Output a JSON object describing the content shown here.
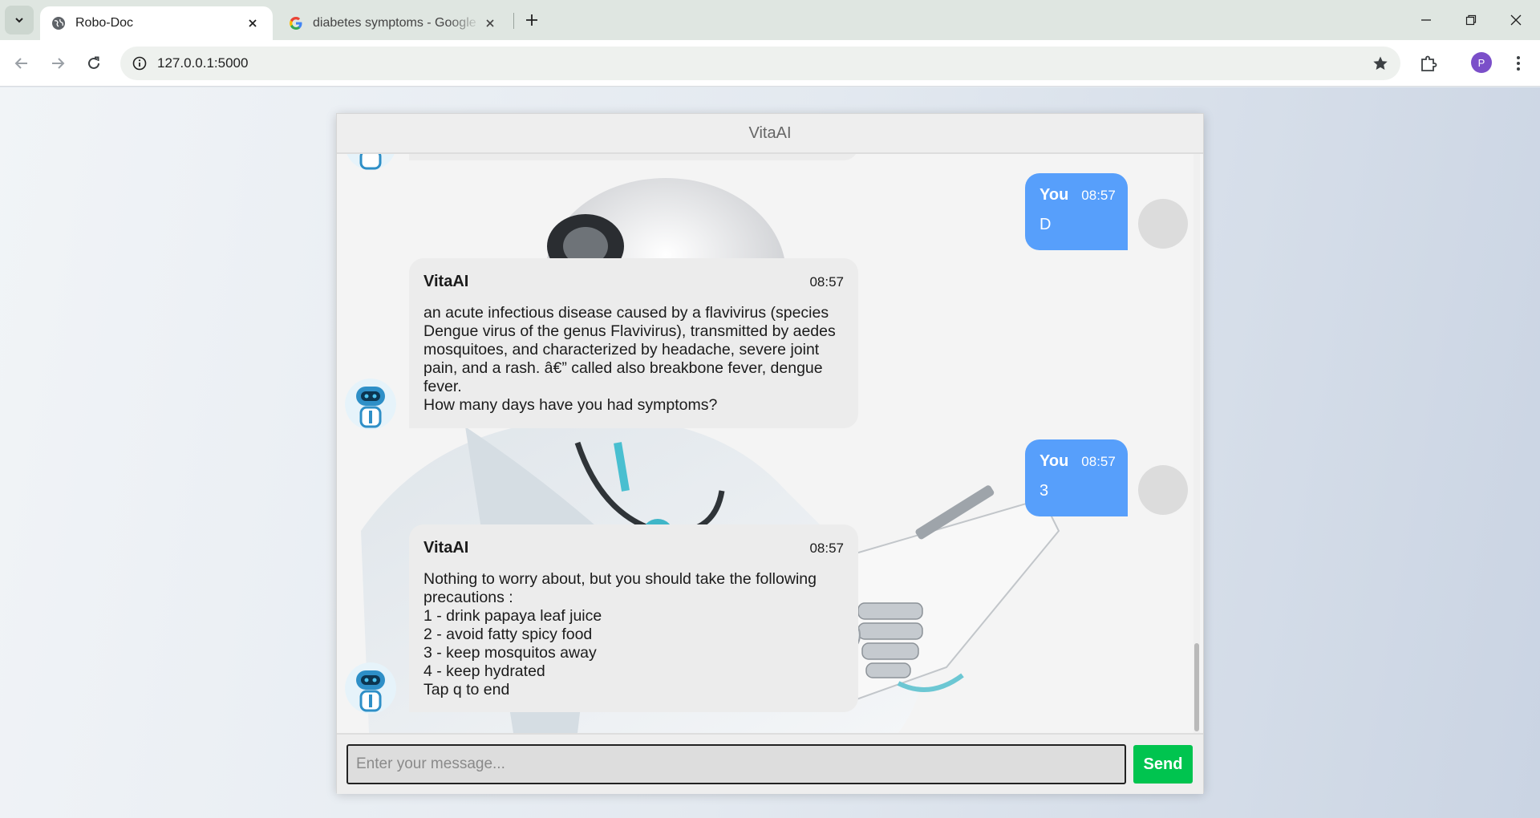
{
  "browser": {
    "tabs": [
      {
        "title": "Robo-Doc",
        "icon": "globe-icon",
        "active": true
      },
      {
        "title": "diabetes symptoms - Google Search",
        "icon": "google-icon",
        "active": false
      }
    ],
    "url": "127.0.0.1:5000",
    "profile_initial": "P",
    "profile_color": "#7b4fc9"
  },
  "chat": {
    "title": "VitaAI",
    "messages": [
      {
        "sender": "You",
        "time": "08:57",
        "text": "D",
        "side": "right"
      },
      {
        "sender": "VitaAI",
        "time": "08:57",
        "text": "an acute infectious disease caused by a flavivirus (species Dengue virus of the genus Flavivirus), transmitted by aedes mosquitoes, and characterized by headache, severe joint pain, and a rash. â€” called also breakbone fever, dengue fever.\nHow many days have you had symptoms?",
        "side": "left"
      },
      {
        "sender": "You",
        "time": "08:57",
        "text": "3",
        "side": "right"
      },
      {
        "sender": "VitaAI",
        "time": "08:57",
        "text": "Nothing to worry about, but you should take the following precautions :\n1 - drink papaya leaf juice\n2 - avoid fatty spicy food\n3 - keep mosquitos away\n4 - keep hydrated\nTap q to end",
        "side": "left"
      }
    ],
    "input_placeholder": "Enter your message...",
    "send_label": "Send",
    "colors": {
      "user_bubble": "#579ffb",
      "bot_bubble": "#ececec",
      "send_button": "#00c44f"
    }
  }
}
